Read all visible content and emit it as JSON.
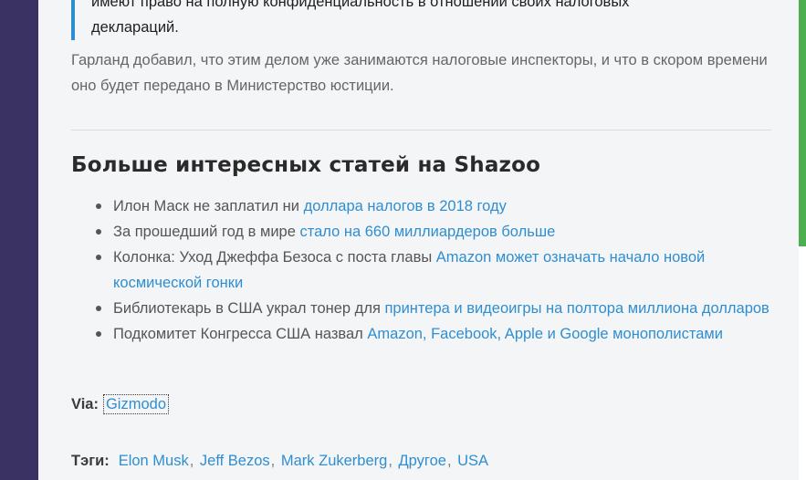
{
  "article": {
    "quote_lines": [
      "имеют право на полную конфиденциальность в отношении своих налоговых",
      "деклараций."
    ],
    "paragraph": "Гарланд добавил, что этим делом уже занимаются налоговые инспекторы, и что в скором времени оно будет передано в Министерство юстиции.",
    "more_heading": "Больше интересных статей на Shazoo",
    "more_items": [
      {
        "text": "Илон Маск не заплатил ни ",
        "link": "доллара налогов в 2018 году"
      },
      {
        "text": "За прошедший год в мире ",
        "link": "стало на 660 миллиардеров больше"
      },
      {
        "text": "Колонка: Уход Джеффа Безоса с поста главы ",
        "link": "Amazon может означать начало новой космической гонки"
      },
      {
        "text": "Библиотекарь в США украл тонер для ",
        "link": "принтера и видеоигры на полтора миллиона долларов"
      },
      {
        "text": "Подкомитет Конгресса США назвал ",
        "link": "Amazon, Facebook, Apple и Google монополистами"
      }
    ],
    "via_label": "Via:",
    "via_source": "Gizmodo",
    "tags_label": "Тэги:",
    "tags": [
      "Elon Musk",
      "Jeff Bezos",
      "Mark Zukerberg",
      "Другое",
      "USA"
    ]
  },
  "colors": {
    "link": "#2f8ed0",
    "sidebar": "#3a3262",
    "background": "#f4f5f7"
  }
}
